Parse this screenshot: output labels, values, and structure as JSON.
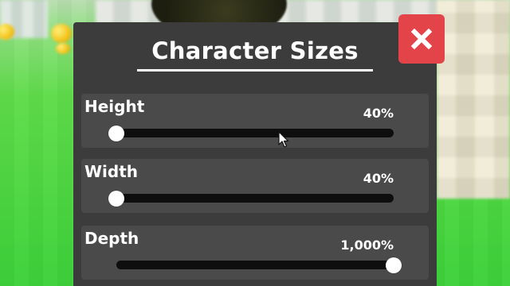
{
  "dialog": {
    "title": "Character Sizes",
    "close_glyph": "✖"
  },
  "sliders": [
    {
      "label": "Height",
      "value_text": "40%",
      "fill_fraction": 0.0
    },
    {
      "label": "Width",
      "value_text": "40%",
      "fill_fraction": 0.0
    },
    {
      "label": "Depth",
      "value_text": "1,000%",
      "fill_fraction": 1.0
    }
  ],
  "icons": {
    "close": "close-icon",
    "cursor": "mouse-cursor-icon"
  },
  "colors": {
    "panel": "#3c3c3c",
    "row": "#4a4a4a",
    "close_button": "#e3444a",
    "track": "#0e0e0e",
    "knob": "#ffffff"
  }
}
